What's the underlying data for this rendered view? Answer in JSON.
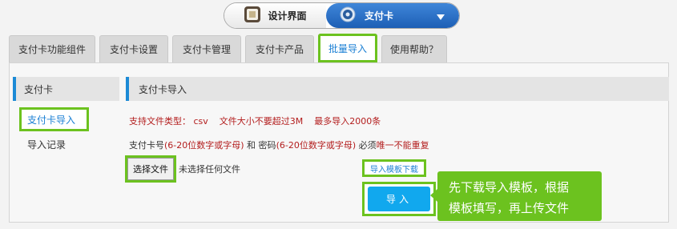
{
  "switcher": {
    "design_label": "设计界面",
    "card_label": "支付卡",
    "design_icon": "design-app-icon",
    "card_icon": "gear-icon",
    "dropdown_icon": "caret-down-icon"
  },
  "tabs": [
    {
      "label": "支付卡功能组件",
      "active": false
    },
    {
      "label": "支付卡设置",
      "active": false
    },
    {
      "label": "支付卡管理",
      "active": false
    },
    {
      "label": "支付卡产品",
      "active": false
    },
    {
      "label": "批量导入",
      "active": true
    },
    {
      "label": "使用帮助？",
      "active": false
    }
  ],
  "sidebar": {
    "title": "支付卡",
    "items": [
      {
        "label": "支付卡导入",
        "active": true
      },
      {
        "label": "导入记录",
        "active": false
      }
    ]
  },
  "main": {
    "title": "支付卡导入",
    "file_type": "支持文件类型： csv",
    "file_size": "文件大小不要超过3M",
    "max_count": "最多导入2000条",
    "rule_prefix": "支付卡号",
    "rule_card": "(6-20位数字或字母)",
    "rule_and": " 和 密码",
    "rule_pwd": "(6-20位数字或字母)",
    "rule_must": " 必须",
    "rule_unique": "唯一不能重复",
    "choose_file": "选择文件",
    "no_file": "未选择任何文件",
    "template_link": "导入模板下载",
    "import_button": "导入"
  },
  "callout": {
    "line1": "先下载导入模板，根据",
    "line2": "模板填写，再上传文件"
  },
  "colors": {
    "accent_blue": "#1a7fd4",
    "highlight_green": "#6cc21f",
    "button_blue": "#11a8ee",
    "warning_red": "#b31d1d"
  }
}
